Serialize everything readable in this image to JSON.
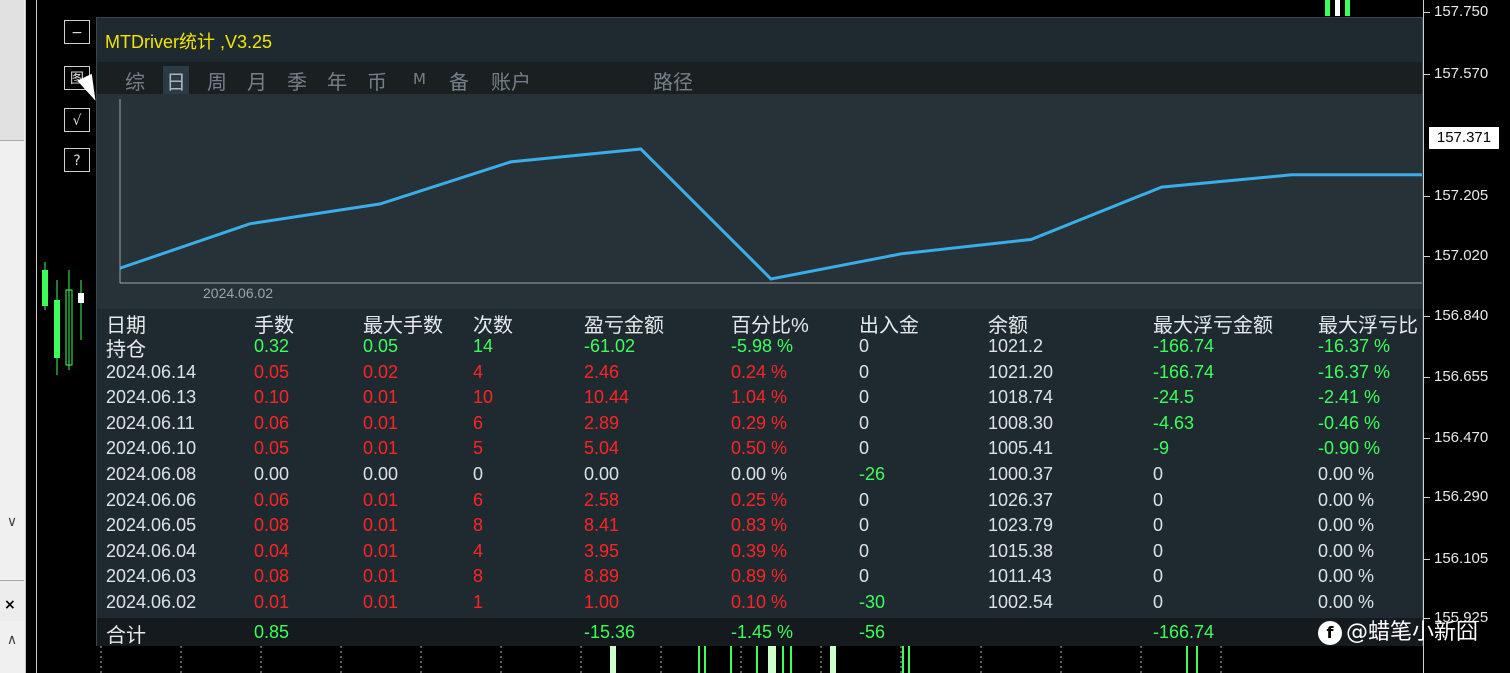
{
  "panel": {
    "title": "MTDriver统计 ,V3.25",
    "tabs": [
      {
        "label": "综",
        "active": false
      },
      {
        "label": "日",
        "active": true
      },
      {
        "label": "周",
        "active": false
      },
      {
        "label": "月",
        "active": false
      },
      {
        "label": "季",
        "active": false
      },
      {
        "label": "年",
        "active": false
      },
      {
        "label": "币",
        "active": false
      },
      {
        "label": "M",
        "active": false
      },
      {
        "label": "备",
        "active": false
      },
      {
        "label": "账户",
        "active": false
      },
      {
        "label": "路径",
        "active": false
      }
    ],
    "plot_start_label": "2024.06.02"
  },
  "chart_data": {
    "type": "line",
    "title": "",
    "x": [
      "2024.06.02",
      "2024.06.03",
      "2024.06.04",
      "2024.06.05",
      "2024.06.06",
      "2024.06.08",
      "2024.06.10",
      "2024.06.11",
      "2024.06.13",
      "2024.06.14",
      "持仓"
    ],
    "series": [
      {
        "values": [
          1002.54,
          1011.43,
          1015.38,
          1023.79,
          1026.37,
          1000.37,
          1005.41,
          1008.3,
          1018.74,
          1021.2,
          1021.2
        ]
      }
    ],
    "color": "#3aaee8"
  },
  "table": {
    "headers": [
      "日期",
      "手数",
      "最大手数",
      "次数",
      "盈亏金额",
      "百分比%",
      "出入金",
      "余额",
      "最大浮亏金额",
      "最大浮亏比"
    ],
    "rows": [
      {
        "date": "持仓",
        "lots": "0.32",
        "max_lots": "0.05",
        "count": "14",
        "pnl": "-61.02",
        "pct": "-5.98 %",
        "flow": "0",
        "balance": "1021.2",
        "max_dd": "-166.74",
        "max_dd_pct": "-16.37 %"
      },
      {
        "date": "2024.06.14",
        "lots": "0.05",
        "max_lots": "0.02",
        "count": "4",
        "pnl": "2.46",
        "pct": "0.24 %",
        "flow": "0",
        "balance": "1021.20",
        "max_dd": "-166.74",
        "max_dd_pct": "-16.37 %"
      },
      {
        "date": "2024.06.13",
        "lots": "0.10",
        "max_lots": "0.01",
        "count": "10",
        "pnl": "10.44",
        "pct": "1.04 %",
        "flow": "0",
        "balance": "1018.74",
        "max_dd": "-24.5",
        "max_dd_pct": "-2.41 %"
      },
      {
        "date": "2024.06.11",
        "lots": "0.06",
        "max_lots": "0.01",
        "count": "6",
        "pnl": "2.89",
        "pct": "0.29 %",
        "flow": "0",
        "balance": "1008.30",
        "max_dd": "-4.63",
        "max_dd_pct": "-0.46 %"
      },
      {
        "date": "2024.06.10",
        "lots": "0.05",
        "max_lots": "0.01",
        "count": "5",
        "pnl": "5.04",
        "pct": "0.50 %",
        "flow": "0",
        "balance": "1005.41",
        "max_dd": "-9",
        "max_dd_pct": "-0.90 %"
      },
      {
        "date": "2024.06.08",
        "lots": "0.00",
        "max_lots": "0.00",
        "count": "0",
        "pnl": "0.00",
        "pct": "0.00 %",
        "flow": "-26",
        "balance": "1000.37",
        "max_dd": "0",
        "max_dd_pct": "0.00 %"
      },
      {
        "date": "2024.06.06",
        "lots": "0.06",
        "max_lots": "0.01",
        "count": "6",
        "pnl": "2.58",
        "pct": "0.25 %",
        "flow": "0",
        "balance": "1026.37",
        "max_dd": "0",
        "max_dd_pct": "0.00 %"
      },
      {
        "date": "2024.06.05",
        "lots": "0.08",
        "max_lots": "0.01",
        "count": "8",
        "pnl": "8.41",
        "pct": "0.83 %",
        "flow": "0",
        "balance": "1023.79",
        "max_dd": "0",
        "max_dd_pct": "0.00 %"
      },
      {
        "date": "2024.06.04",
        "lots": "0.04",
        "max_lots": "0.01",
        "count": "4",
        "pnl": "3.95",
        "pct": "0.39 %",
        "flow": "0",
        "balance": "1015.38",
        "max_dd": "0",
        "max_dd_pct": "0.00 %"
      },
      {
        "date": "2024.06.03",
        "lots": "0.08",
        "max_lots": "0.01",
        "count": "8",
        "pnl": "8.89",
        "pct": "0.89 %",
        "flow": "0",
        "balance": "1011.43",
        "max_dd": "0",
        "max_dd_pct": "0.00 %"
      },
      {
        "date": "2024.06.02",
        "lots": "0.01",
        "max_lots": "0.01",
        "count": "1",
        "pnl": "1.00",
        "pct": "0.10 %",
        "flow": "-30",
        "balance": "1002.54",
        "max_dd": "0",
        "max_dd_pct": "0.00 %"
      }
    ],
    "total": {
      "label": "合计",
      "lots": "0.85",
      "pnl": "-15.36",
      "pct": "-1.45 %",
      "flow": "-56",
      "max_dd": "-166.74"
    }
  },
  "price_axis": {
    "labels": [
      "157.750",
      "157.570",
      "157.205",
      "157.020",
      "156.840",
      "156.655",
      "156.470",
      "156.290",
      "156.105",
      "155.925"
    ],
    "current": "157.371"
  },
  "toolbar": {
    "minimize": "−",
    "stats": "图",
    "check": "√",
    "help": "?"
  },
  "left_strip": {
    "chev1": "∨",
    "close": "×",
    "chev2": "∧"
  },
  "watermark": "@蜡笔小新囧",
  "colors": {
    "panel_bg": "#1f2a30",
    "line": "#3aaee8",
    "title": "#f2e500",
    "positive": "#3dff5a",
    "negative": "#ff2424"
  }
}
